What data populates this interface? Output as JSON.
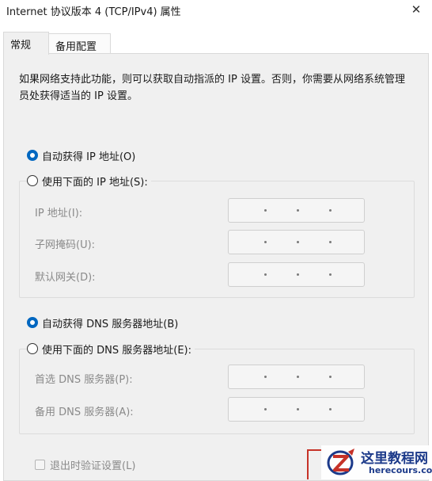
{
  "window": {
    "title": "Internet 协议版本 4 (TCP/IPv4) 属性",
    "close_glyph": "✕"
  },
  "tabs": [
    {
      "label": "常规",
      "active": true
    },
    {
      "label": "备用配置",
      "active": false
    }
  ],
  "general": {
    "description": "如果网络支持此功能，则可以获取自动指派的 IP 设置。否则，你需要从网络系统管理员处获得适当的 IP 设置。",
    "ip": {
      "auto_label": "自动获得 IP 地址(O)",
      "auto_checked": true,
      "manual_label": "使用下面的 IP 地址(S):",
      "manual_checked": false,
      "fields": [
        {
          "label": "IP 地址(I):",
          "value": "",
          "enabled": false
        },
        {
          "label": "子网掩码(U):",
          "value": "",
          "enabled": false
        },
        {
          "label": "默认网关(D):",
          "value": "",
          "enabled": false
        }
      ]
    },
    "dns": {
      "auto_label": "自动获得 DNS 服务器地址(B)",
      "auto_checked": true,
      "manual_label": "使用下面的 DNS 服务器地址(E):",
      "manual_checked": false,
      "fields": [
        {
          "label": "首选 DNS 服务器(P):",
          "value": "",
          "enabled": false
        },
        {
          "label": "备用 DNS 服务器(A):",
          "value": "",
          "enabled": false
        }
      ]
    },
    "validate_on_exit": {
      "label": "退出时验证设置(L)",
      "checked": false,
      "enabled": false
    }
  },
  "watermark": {
    "title": "这里教程网",
    "site": "herecours.com",
    "accent": "#1c3a8a",
    "logo_color": "#c63228"
  }
}
